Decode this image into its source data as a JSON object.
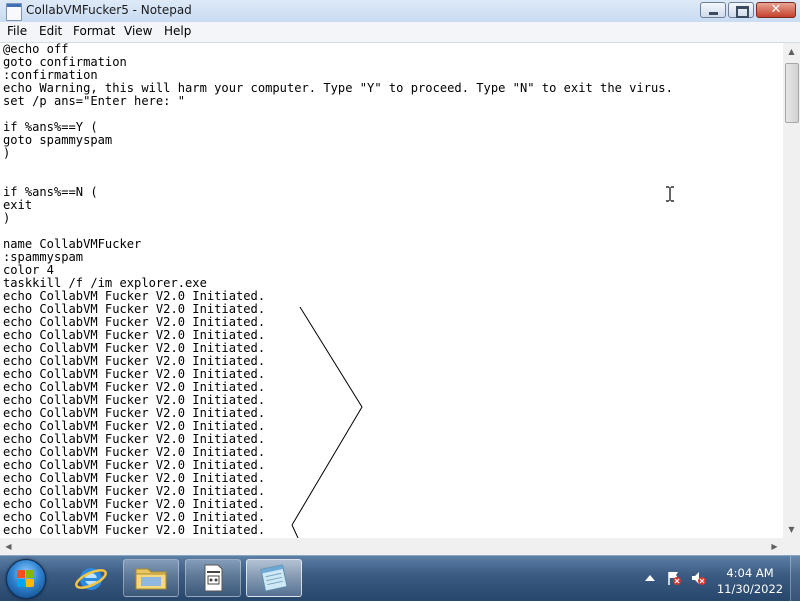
{
  "window": {
    "title": "CollabVMFucker5 - Notepad",
    "minimize_glyph": "minimize",
    "maximize_glyph": "maximize",
    "close_glyph": "✕"
  },
  "menu": {
    "file": "File",
    "edit": "Edit",
    "format": "Format",
    "view": "View",
    "help": "Help"
  },
  "editor": {
    "lines": [
      "@echo off",
      "goto confirmation",
      ":confirmation",
      "echo Warning, this will harm your computer. Type \"Y\" to proceed. Type \"N\" to exit the virus.",
      "set /p ans=\"Enter here: \"",
      "",
      "if %ans%==Y (",
      "goto spammyspam",
      ")",
      "",
      "",
      "if %ans%==N (",
      "exit",
      ")",
      "",
      "name CollabVMFucker",
      ":spammyspam",
      "color 4",
      "taskkill /f /im explorer.exe",
      "echo CollabVM Fucker V2.0 Initiated.",
      "echo CollabVM Fucker V2.0 Initiated.",
      "echo CollabVM Fucker V2.0 Initiated.",
      "echo CollabVM Fucker V2.0 Initiated.",
      "echo CollabVM Fucker V2.0 Initiated.",
      "echo CollabVM Fucker V2.0 Initiated.",
      "echo CollabVM Fucker V2.0 Initiated.",
      "echo CollabVM Fucker V2.0 Initiated.",
      "echo CollabVM Fucker V2.0 Initiated.",
      "echo CollabVM Fucker V2.0 Initiated.",
      "echo CollabVM Fucker V2.0 Initiated.",
      "echo CollabVM Fucker V2.0 Initiated.",
      "echo CollabVM Fucker V2.0 Initiated.",
      "echo CollabVM Fucker V2.0 Initiated.",
      "echo CollabVM Fucker V2.0 Initiated.",
      "echo CollabVM Fucker V2.0 Initiated.",
      "echo CollabVM Fucker V2.0 Initiated.",
      "echo CollabVM Fucker V2.0 Initiated.",
      "echo CollabVM Fucker V2.0 Initiated."
    ]
  },
  "scrollbars": {
    "up_glyph": "▲",
    "down_glyph": "▼",
    "left_glyph": "◀",
    "right_glyph": "▶"
  },
  "taskbar": {
    "time": "4:04 AM",
    "date": "11/30/2022",
    "items": [
      {
        "name": "internet-explorer",
        "icon": "ie-icon"
      },
      {
        "name": "windows-explorer",
        "icon": "folder-icon"
      },
      {
        "name": "file-preview",
        "icon": "document-icon"
      },
      {
        "name": "notepad",
        "icon": "notepad-icon"
      }
    ]
  },
  "colors": {
    "accent": "#2f82d0",
    "taskbar": "#3c5c83",
    "close_button": "#c4412b"
  }
}
